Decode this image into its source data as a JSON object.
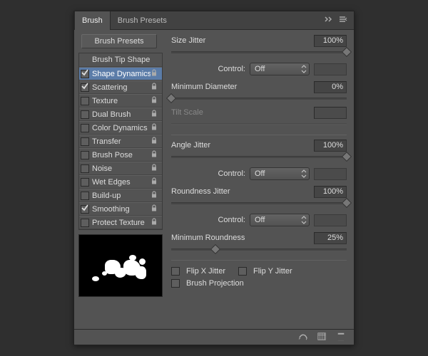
{
  "tabs": {
    "active": "Brush",
    "other": "Brush Presets"
  },
  "presets_button": "Brush Presets",
  "list": [
    {
      "label": "Brush Tip Shape",
      "noCheckbox": true,
      "selected": false,
      "lock": false
    },
    {
      "label": "Shape Dynamics",
      "checked": true,
      "selected": true,
      "lock": true
    },
    {
      "label": "Scattering",
      "checked": true,
      "lock": true
    },
    {
      "label": "Texture",
      "checked": false,
      "lock": true
    },
    {
      "label": "Dual Brush",
      "checked": false,
      "lock": true
    },
    {
      "label": "Color Dynamics",
      "checked": false,
      "lock": true
    },
    {
      "label": "Transfer",
      "checked": false,
      "lock": true
    },
    {
      "label": "Brush Pose",
      "checked": false,
      "lock": true
    },
    {
      "label": "Noise",
      "checked": false,
      "lock": true
    },
    {
      "label": "Wet Edges",
      "checked": false,
      "lock": true
    },
    {
      "label": "Build-up",
      "checked": false,
      "lock": true
    },
    {
      "label": "Smoothing",
      "checked": true,
      "lock": true
    },
    {
      "label": "Protect Texture",
      "checked": false,
      "lock": true
    }
  ],
  "props": {
    "size_jitter": {
      "label": "Size Jitter",
      "value": "100%",
      "pos": 100
    },
    "control1": {
      "label": "Control:",
      "value": "Off"
    },
    "min_diameter": {
      "label": "Minimum Diameter",
      "value": "0%",
      "pos": 0
    },
    "tilt_scale": {
      "label": "Tilt Scale"
    },
    "angle_jitter": {
      "label": "Angle Jitter",
      "value": "100%",
      "pos": 100
    },
    "control2": {
      "label": "Control:",
      "value": "Off"
    },
    "roundness_jitter": {
      "label": "Roundness Jitter",
      "value": "100%",
      "pos": 100
    },
    "control3": {
      "label": "Control:",
      "value": "Off"
    },
    "min_roundness": {
      "label": "Minimum Roundness",
      "value": "25%",
      "pos": 25
    },
    "flip_x": {
      "label": "Flip X Jitter",
      "checked": false
    },
    "flip_y": {
      "label": "Flip Y Jitter",
      "checked": false
    },
    "brush_proj": {
      "label": "Brush Projection",
      "checked": false
    }
  }
}
